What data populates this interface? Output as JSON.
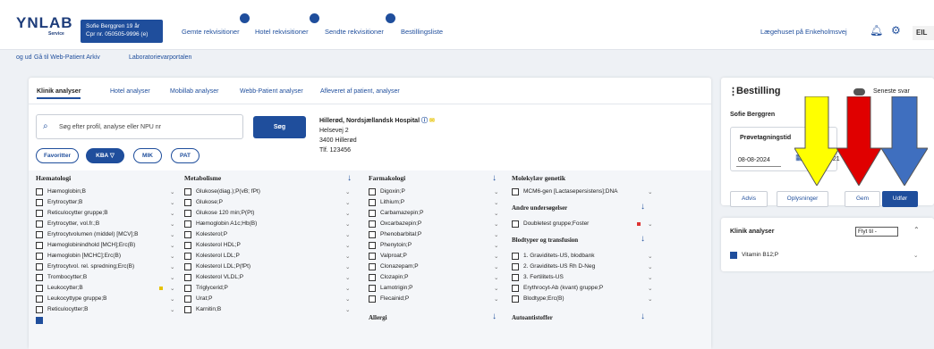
{
  "topbar": {
    "logo": "YNLAB",
    "logo_sub": "Service",
    "patient_name": "Sofie Berggren 19 år",
    "patient_cpr": "Cpr nr. 050505-9996 (e)",
    "links": [
      "Gemte rekvisitioner",
      "Hotel rekvisitioner",
      "Sendte rekvisitioner",
      "Bestillingsliste"
    ],
    "clinic": "Lægehuset på Enkeholmsvej",
    "user_initials": "EIL"
  },
  "subnav": [
    "og ud",
    "Gå til Web-Patient Arkiv",
    "Laboratorievarportalen"
  ],
  "tabs": [
    "Klinik analyser",
    "Hotel analyser",
    "Mobillab analyser",
    "Webb-Patient analyser",
    "Afleveret af patient, analyser"
  ],
  "search": {
    "placeholder": "Søg efter profil, analyse eller NPU nr",
    "button": "Søg"
  },
  "hospital": {
    "name": "Hillerød, Nordsjællandsk Hospital",
    "street": "Helsevej 2",
    "city": "3400 Hillerød",
    "phone": "Tlf. 123456"
  },
  "filters": [
    "Favoritter",
    "KBA",
    "MIK",
    "PAT"
  ],
  "columns": {
    "haematologi": {
      "title": "Hæmatologi",
      "items": [
        "Hæmoglobin;B",
        "Erytrocytter;B",
        "Reticulocytter gruppe;B",
        "Erytrocytter, vol.fr.;B",
        "Erytrocytvolumen (middel) [MCV];B",
        "Hæmoglobinindhold [MCH];Erc(B)",
        "Hæmoglobin [MCHC];Erc(B)",
        "Erytrocytvol. rel. spredning;Erc(B)",
        "Trombocytter;B",
        "Leukocytter;B",
        "Leukocyttype gruppe;B",
        "Reticulocytter;B"
      ]
    },
    "metabolisme": {
      "title": "Metabolisme",
      "items": [
        "Glukose(diag.);P(vB; fPt)",
        "Glukose;P",
        "Glukose 120 min;P(Pt)",
        "Hæmoglobin A1c;Hb(B)",
        "Kolesterol;P",
        "Kolesterol HDL;P",
        "Kolesterol LDL;P",
        "Kolesterol LDL;P(fPt)",
        "Kolesterol VLDL;P",
        "Triglycerid;P",
        "Urat;P",
        "Karnitin;B"
      ]
    },
    "farmakologi": {
      "title": "Farmakologi",
      "items": [
        "Digoxin;P",
        "Lithium;P",
        "Carbamazepin;P",
        "Oxcarbazepin;P",
        "Phenobarbital;P",
        "Phenytoin;P",
        "Valproat;P",
        "Clonazepam;P",
        "Clozapin;P",
        "Lamotrigin;P",
        "Flecainid;P"
      ],
      "next_section": "Allergi"
    },
    "molekylaer": {
      "title": "Molekylær genetik",
      "items": [
        "MCM6-gen [Lactasepersistens];DNA"
      ],
      "andre_title": "Andre undersøgelser",
      "andre_items": [
        "Doubletest gruppe;Foster"
      ],
      "blod_title": "Blodtyper og transfusion",
      "blod_items": [
        "1. Graviditets-US, blodbank",
        "2. Graviditets-US Rh D-Neg",
        "3. Fertilitets-US",
        "Erythrocyt-Ab (kvant) gruppe;P",
        "Blodtype;Erc(B)"
      ],
      "next_section": "Autoantistoffer"
    }
  },
  "bestilling": {
    "title": "Bestilling",
    "seneste": "Seneste svar",
    "patient": "Sofie Berggren",
    "patient_num": "05050",
    "prove_label": "Prøvetagningstid",
    "date": "08-08-2024",
    "time": "3:21",
    "buttons": [
      "Advis",
      "Oplysninger",
      "Gem",
      "Udfør"
    ]
  },
  "klinik_card": {
    "title": "Klinik analyser",
    "select": "Flyt til -",
    "item": "Vitamin B12;P"
  },
  "colors": {
    "brand": "#1f4e9c",
    "arrow_yellow": "#ffff00",
    "arrow_red": "#e00000",
    "arrow_blue": "#3f6fbf"
  }
}
